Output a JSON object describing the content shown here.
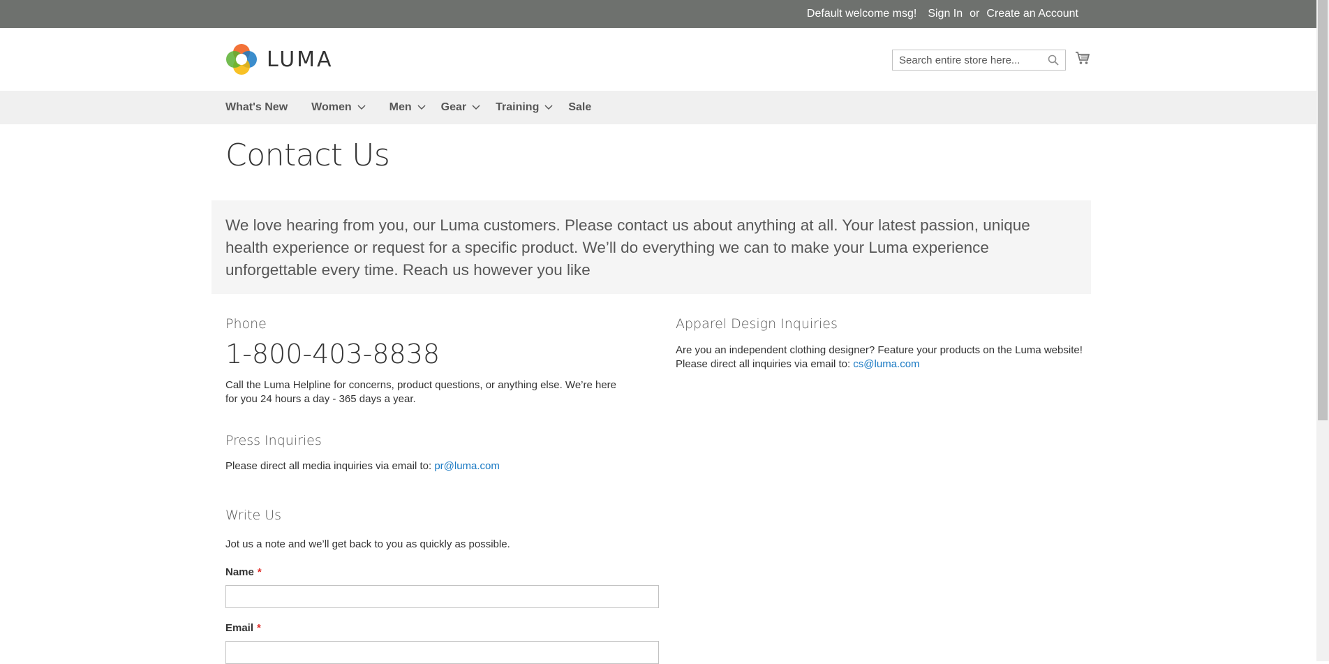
{
  "top_panel": {
    "welcome": "Default welcome msg!",
    "sign_in": "Sign In",
    "or": "or",
    "create_account": "Create an Account"
  },
  "header": {
    "logo_text": "LUMA",
    "search_placeholder": "Search entire store here...",
    "search_icon": "search-icon",
    "cart_icon": "cart-icon"
  },
  "nav": {
    "items": [
      {
        "label": "What's New",
        "has_dropdown": false
      },
      {
        "label": "Women",
        "has_dropdown": true
      },
      {
        "label": "Men",
        "has_dropdown": true
      },
      {
        "label": "Gear",
        "has_dropdown": true
      },
      {
        "label": "Training",
        "has_dropdown": true
      },
      {
        "label": "Sale",
        "has_dropdown": false
      }
    ]
  },
  "main": {
    "title": "Contact Us",
    "intro": "We love hearing from you, our Luma customers. Please contact us about anything at all. Your latest passion, unique health experience or request for a specific product. We’ll do everything we can to make your Luma experience unforgettable every time. Reach us however you like",
    "phone": {
      "heading": "Phone",
      "number": "1-800-403-8838",
      "description": "Call the Luma Helpline for concerns, product questions, or anything else. We’re here for you 24 hours a day - 365 days a year."
    },
    "apparel": {
      "heading": "Apparel Design Inquiries",
      "text_line1": "Are you an independent clothing designer? Feature your products on the Luma website!",
      "text_line2": "Please direct all inquiries via email to:",
      "email": "cs@luma.com"
    },
    "press": {
      "heading": "Press Inquiries",
      "text": "Please direct all media inquiries via email to:",
      "email": "pr@luma.com"
    },
    "write_us": {
      "heading": "Write Us",
      "text": "Jot us a note and we’ll get back to you as quickly as possible.",
      "name_label": "Name",
      "email_label": "Email",
      "required_mark": "*",
      "name_value": "",
      "email_value": ""
    }
  },
  "colors": {
    "top_panel_bg": "#6e716e",
    "nav_bg": "#f0f0f0",
    "link": "#1979c3",
    "required": "#e02b27"
  }
}
